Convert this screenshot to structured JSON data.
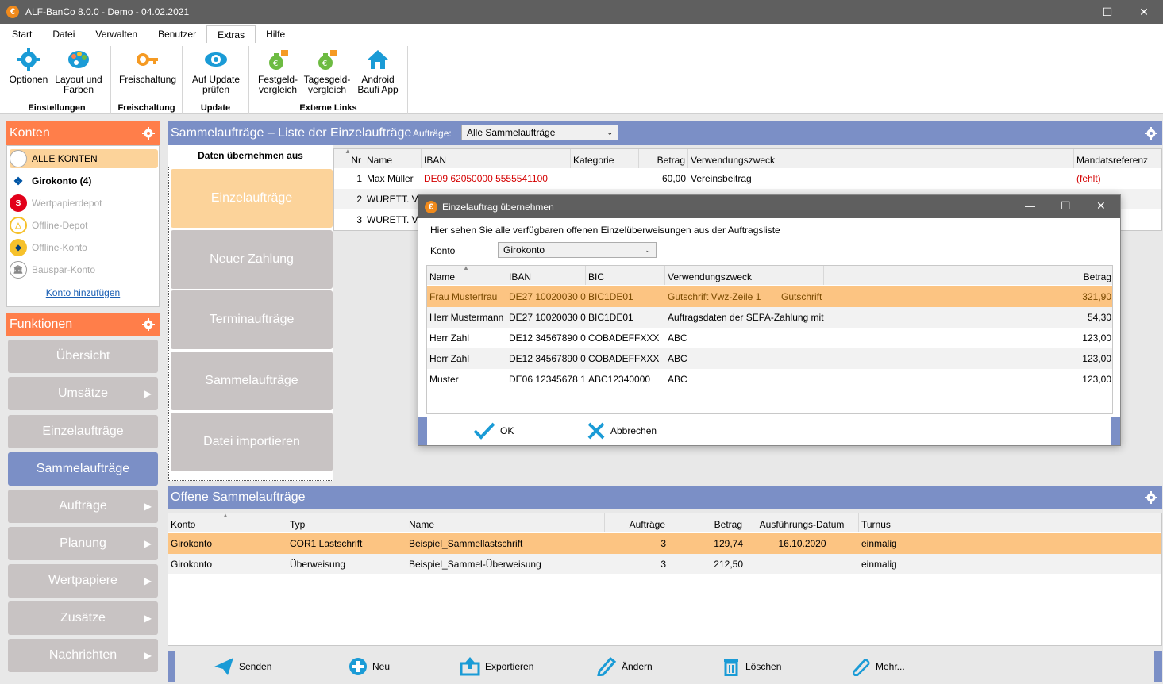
{
  "window": {
    "title": "ALF-BanCo 8.0.0 - Demo  -  04.02.2021",
    "app_icon": "€"
  },
  "menu": [
    "Start",
    "Datei",
    "Verwalten",
    "Benutzer",
    "Extras",
    "Hilfe"
  ],
  "ribbon": {
    "einstellungen": {
      "label": "Einstellungen",
      "optionen": "Optionen",
      "layout1": "Layout und",
      "layout2": "Farben"
    },
    "freischaltung": {
      "label": "Freischaltung",
      "btn": "Freischaltung"
    },
    "update": {
      "label": "Update",
      "btn1": "Auf Update",
      "btn2": "prüfen"
    },
    "links": {
      "label": "Externe Links",
      "fest1": "Festgeld-",
      "fest2": "vergleich",
      "tages1": "Tagesgeld-",
      "tages2": "vergleich",
      "android1": "Android",
      "android2": "Baufi App"
    }
  },
  "konten": {
    "title": "Konten",
    "items": [
      {
        "label": "ALLE KONTEN",
        "icon": "circle-icon"
      },
      {
        "label": "Girokonto (4)",
        "icon": "volksbank-icon"
      },
      {
        "label": "Wertpapierdepot",
        "icon": "sparkasse-icon"
      },
      {
        "label": "Offline-Depot",
        "icon": "triangle-icon"
      },
      {
        "label": "Offline-Konto",
        "icon": "commerzbank-icon"
      },
      {
        "label": "Bauspar-Konto",
        "icon": "bank-icon"
      }
    ],
    "add_link": "Konto hinzufügen"
  },
  "funktionen": {
    "title": "Funktionen",
    "items": [
      "Übersicht",
      "Umsätze",
      "Einzelaufträge",
      "Sammelaufträge",
      "Aufträge",
      "Planung",
      "Wertpapiere",
      "Zusätze",
      "Nachrichten"
    ]
  },
  "sammel": {
    "title": "Sammelaufträge – Liste der Einzelaufträge",
    "filter_label": "Aufträge:",
    "filter_value": "Alle Sammelaufträge"
  },
  "daten": {
    "title": "Daten übernehmen aus",
    "buttons": [
      "Einzelaufträge",
      "Neuer Zahlung",
      "Terminaufträge",
      "Sammelaufträge",
      "Datei importieren"
    ]
  },
  "einzel_grid": {
    "headers": [
      "Nr",
      "Name",
      "IBAN",
      "Kategorie",
      "Betrag",
      "Verwendungszweck",
      "Mandatsreferenz"
    ],
    "rows": [
      [
        "1",
        "Max Müller",
        "DE09 62050000 5555541100",
        "",
        "60,00",
        "Vereinsbeitrag",
        "(fehlt)"
      ],
      [
        "2",
        "WURETT. V",
        "",
        "",
        "",
        "",
        ""
      ],
      [
        "3",
        "WURETT. V",
        "",
        "",
        "",
        "",
        ""
      ]
    ]
  },
  "dialog": {
    "title": "Einzelauftrag übernehmen",
    "info": "Hier sehen Sie alle verfügbaren offenen Einzelüberweisungen aus der Auftragsliste",
    "konto_label": "Konto",
    "konto_value": "Girokonto",
    "headers": [
      "Name",
      "IBAN",
      "BIC",
      "Verwendungszweck",
      "",
      "Betrag"
    ],
    "rows": [
      [
        "Frau Musterfrau",
        "DE27 10020030 0",
        "BIC1DE01",
        "Gutschrift Vwz-Zeile 1",
        "Gutschrift",
        "321,90"
      ],
      [
        "Herr Mustermann",
        "DE27 10020030 0",
        "BIC1DE01",
        "Auftragsdaten der SEPA-Zahlung mit",
        "",
        "54,30"
      ],
      [
        "Herr Zahl",
        "DE12 34567890 0",
        "COBADEFFXXX",
        "ABC",
        "",
        "123,00"
      ],
      [
        "Herr Zahl",
        "DE12 34567890 0",
        "COBADEFFXXX",
        "ABC",
        "",
        "123,00"
      ],
      [
        "Muster",
        "DE06 12345678 1",
        "ABC12340000",
        "ABC",
        "",
        "123,00"
      ]
    ],
    "ok": "OK",
    "cancel": "Abbrechen"
  },
  "offene": {
    "title": "Offene Sammelaufträge",
    "headers": [
      "Konto",
      "Typ",
      "Name",
      "Aufträge",
      "Betrag",
      "Ausführungs-Datum",
      "Turnus"
    ],
    "rows": [
      [
        "Girokonto",
        "COR1 Lastschrift",
        "Beispiel_Sammellastschrift",
        "3",
        "129,74",
        "16.10.2020",
        "einmalig"
      ],
      [
        "Girokonto",
        "Überweisung",
        "Beispiel_Sammel-Überweisung",
        "3",
        "212,50",
        "",
        "einmalig"
      ]
    ]
  },
  "toolbar": {
    "senden": "Senden",
    "neu": "Neu",
    "exportieren": "Exportieren",
    "aendern": "Ändern",
    "loeschen": "Löschen",
    "mehr": "Mehr..."
  },
  "colors": {
    "orange": "#ff7e4a",
    "blue": "#7b8fc6",
    "selected": "#fcc482",
    "accent": "#1a9bd6",
    "red": "#d40000"
  }
}
